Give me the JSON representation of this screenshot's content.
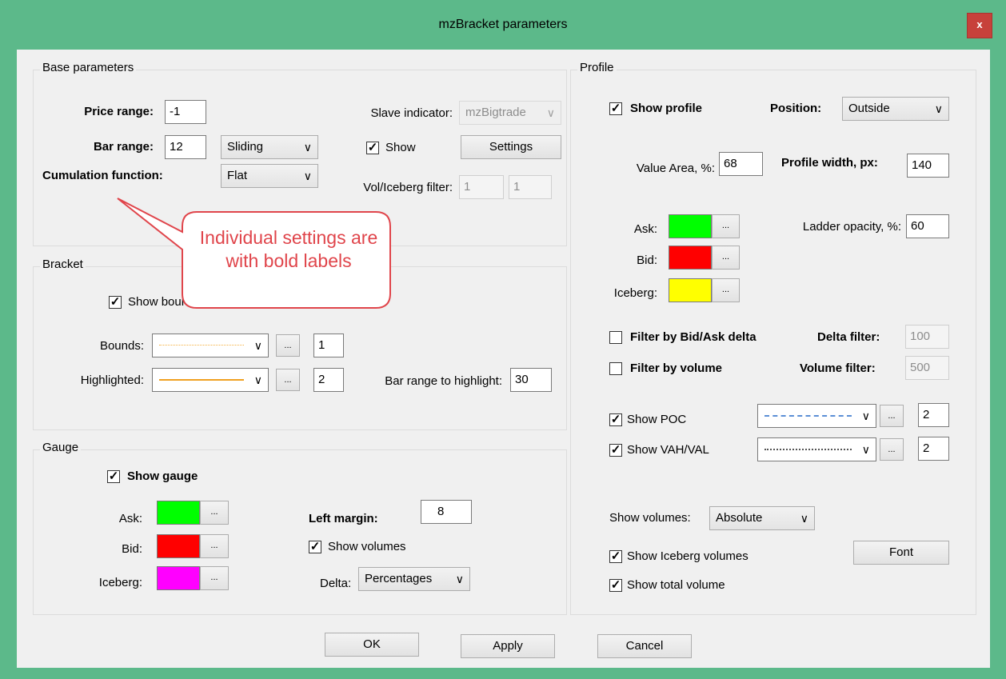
{
  "window": {
    "title": "mzBracket parameters",
    "close_glyph": "x",
    "frame_color": "#5cb98a",
    "close_color": "#c7413b"
  },
  "base": {
    "title": "Base parameters",
    "price_range_label": "Price range:",
    "price_range_value": "-1",
    "bar_range_label": "Bar range:",
    "bar_range_value": "12",
    "bar_range_mode": "Sliding",
    "cumulation_label": "Cumulation function:",
    "cumulation_value": "Flat",
    "slave_label": "Slave indicator:",
    "slave_value": "mzBigtrade",
    "show_label": "Show",
    "show_checked": true,
    "settings_label": "Settings",
    "vol_filter_label": "Vol/Iceberg filter:",
    "vol_filter_1": "1",
    "vol_filter_2": "1"
  },
  "callout": {
    "text": "Individual settings are with bold labels",
    "color": "#e0454b"
  },
  "bracket": {
    "title": "Bracket",
    "show_bounds_label": "Show bounds",
    "show_bounds_checked": true,
    "bounds_label": "Bounds:",
    "bounds_width": "1",
    "bounds_color": "#f5b041",
    "highlighted_label": "Highlighted:",
    "highlighted_width": "2",
    "highlighted_color": "#f0a020",
    "bar_range_highlight_label": "Bar range to highlight:",
    "bar_range_highlight_value": "30",
    "ellipsis": "..."
  },
  "gauge": {
    "title": "Gauge",
    "show_gauge_label": "Show gauge",
    "show_gauge_checked": true,
    "ask_label": "Ask:",
    "ask_color": "#00ff00",
    "bid_label": "Bid:",
    "bid_color": "#ff0000",
    "iceberg_label": "Iceberg:",
    "iceberg_color": "#ff00ff",
    "left_margin_label": "Left margin:",
    "left_margin_value": "8",
    "show_volumes_label": "Show volumes",
    "show_volumes_checked": true,
    "delta_label": "Delta:",
    "delta_value": "Percentages",
    "ellipsis": "..."
  },
  "profile": {
    "title": "Profile",
    "show_profile_label": "Show profile",
    "show_profile_checked": true,
    "position_label": "Position:",
    "position_value": "Outside",
    "value_area_label": "Value Area, %:",
    "value_area_value": "68",
    "profile_width_label": "Profile width, px:",
    "profile_width_value": "140",
    "ask_label": "Ask:",
    "ask_color": "#00ff00",
    "bid_label": "Bid:",
    "bid_color": "#ff0000",
    "iceberg_label": "Iceberg:",
    "iceberg_color": "#ffff00",
    "ladder_opacity_label": "Ladder opacity, %:",
    "ladder_opacity_value": "60",
    "filter_delta_label": "Filter by Bid/Ask delta",
    "filter_delta_checked": false,
    "delta_filter_label": "Delta filter:",
    "delta_filter_value": "100",
    "filter_volume_label": "Filter by volume",
    "filter_volume_checked": false,
    "volume_filter_label": "Volume filter:",
    "volume_filter_value": "500",
    "show_poc_label": "Show POC",
    "show_poc_checked": true,
    "poc_color": "#5b8fd6",
    "poc_width": "2",
    "show_vah_label": "Show VAH/VAL",
    "show_vah_checked": true,
    "vah_color": "#555555",
    "vah_width": "2",
    "show_volumes_label": "Show volumes:",
    "show_volumes_value": "Absolute",
    "show_iceberg_label": "Show Iceberg volumes",
    "show_iceberg_checked": true,
    "show_total_label": "Show total volume",
    "show_total_checked": true,
    "font_label": "Font",
    "ellipsis": "..."
  },
  "footer": {
    "ok_label": "OK",
    "apply_label": "Apply",
    "cancel_label": "Cancel"
  },
  "icons": {
    "check": "✓",
    "dropdown": "chevron-down-icon"
  }
}
